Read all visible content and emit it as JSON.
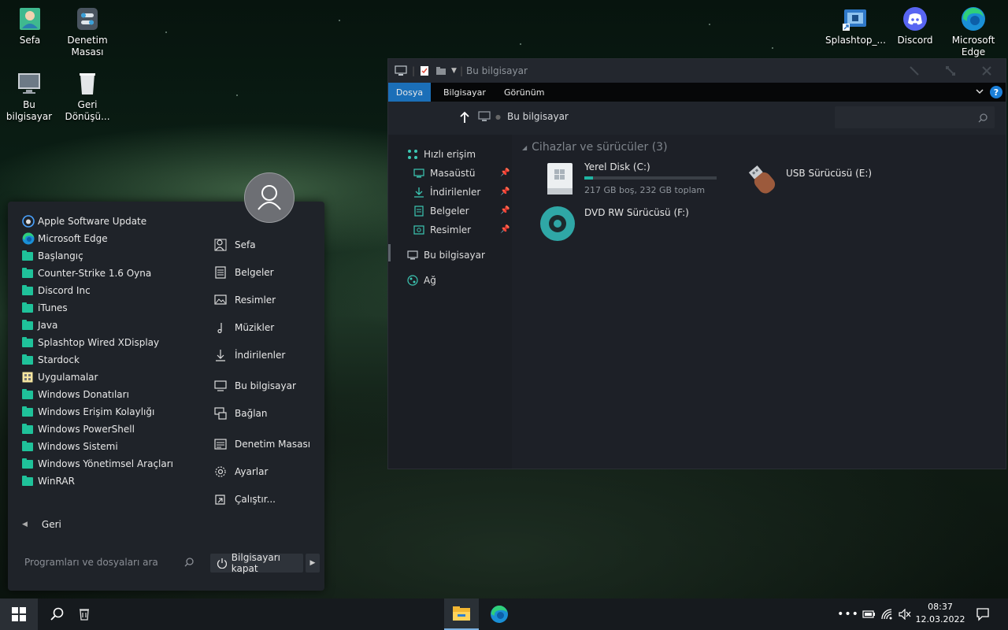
{
  "desktop": {
    "icons": [
      {
        "label": "Sefa",
        "icon": "user-folder-icon"
      },
      {
        "label": "Denetim Masası",
        "icon": "control-panel-icon"
      },
      {
        "label": "Bu bilgisayar",
        "icon": "computer-icon"
      },
      {
        "label": "Geri Dönüşü...",
        "icon": "recycle-bin-icon"
      },
      {
        "label": "Splashtop_...",
        "icon": "splashtop-icon"
      },
      {
        "label": "Discord",
        "icon": "discord-icon"
      },
      {
        "label": "Microsoft Edge",
        "icon": "edge-icon"
      }
    ]
  },
  "start_menu": {
    "programs": [
      {
        "label": "Apple Software Update",
        "icon": "apple-update-icon"
      },
      {
        "label": "Microsoft Edge",
        "icon": "edge-icon"
      },
      {
        "label": "Başlangıç",
        "icon": "folder-icon"
      },
      {
        "label": "Counter-Strike 1.6 Oyna",
        "icon": "folder-icon"
      },
      {
        "label": "Discord Inc",
        "icon": "folder-icon"
      },
      {
        "label": "iTunes",
        "icon": "folder-icon"
      },
      {
        "label": "Java",
        "icon": "folder-icon"
      },
      {
        "label": "Splashtop Wired XDisplay",
        "icon": "folder-icon"
      },
      {
        "label": "Stardock",
        "icon": "folder-icon"
      },
      {
        "label": "Uygulamalar",
        "icon": "apps-icon"
      },
      {
        "label": "Windows Donatıları",
        "icon": "folder-icon"
      },
      {
        "label": "Windows Erişim Kolaylığı",
        "icon": "folder-icon"
      },
      {
        "label": "Windows PowerShell",
        "icon": "folder-icon"
      },
      {
        "label": "Windows Sistemi",
        "icon": "folder-icon"
      },
      {
        "label": "Windows Yönetimsel Araçları",
        "icon": "folder-icon"
      },
      {
        "label": "WinRAR",
        "icon": "folder-icon"
      }
    ],
    "back_label": "Geri",
    "right_items": [
      {
        "label": "Sefa",
        "icon": "user-icon"
      },
      {
        "label": "Belgeler",
        "icon": "document-icon"
      },
      {
        "label": "Resimler",
        "icon": "picture-icon"
      },
      {
        "label": "Müzikler",
        "icon": "music-icon"
      },
      {
        "label": "İndirilenler",
        "icon": "download-icon"
      },
      {
        "label": "Bu bilgisayar",
        "icon": "computer-icon"
      },
      {
        "label": "Bağlan",
        "icon": "connect-icon"
      },
      {
        "label": "Denetim Masası",
        "icon": "control-panel-icon"
      },
      {
        "label": "Ayarlar",
        "icon": "gear-icon"
      },
      {
        "label": "Çalıştır...",
        "icon": "run-icon"
      }
    ],
    "search_placeholder": "Programları ve dosyaları ara",
    "power_label": "Bilgisayarı kapat"
  },
  "explorer": {
    "title": "Bu bilgisayar",
    "tabs": [
      "Dosya",
      "Bilgisayar",
      "Görünüm"
    ],
    "active_tab": "Dosya",
    "address": "Bu bilgisayar",
    "nav": {
      "quick_access": "Hızlı erişim",
      "quick_items": [
        "Masaüstü",
        "İndirilenler",
        "Belgeler",
        "Resimler"
      ],
      "this_pc": "Bu bilgisayar",
      "network": "Ağ"
    },
    "section_title": "Cihazlar ve sürücüler (3)",
    "drives": [
      {
        "name": "Yerel Disk (C:)",
        "detail": "217 GB boş, 232 GB toplam",
        "used_fraction": 0.065
      },
      {
        "name": "USB Sürücüsü (E:)"
      },
      {
        "name": "DVD RW Sürücüsü (F:)"
      }
    ],
    "accent_color": "#1fb5a3"
  },
  "taskbar": {
    "time": "08:37",
    "date": "12.03.2022"
  }
}
